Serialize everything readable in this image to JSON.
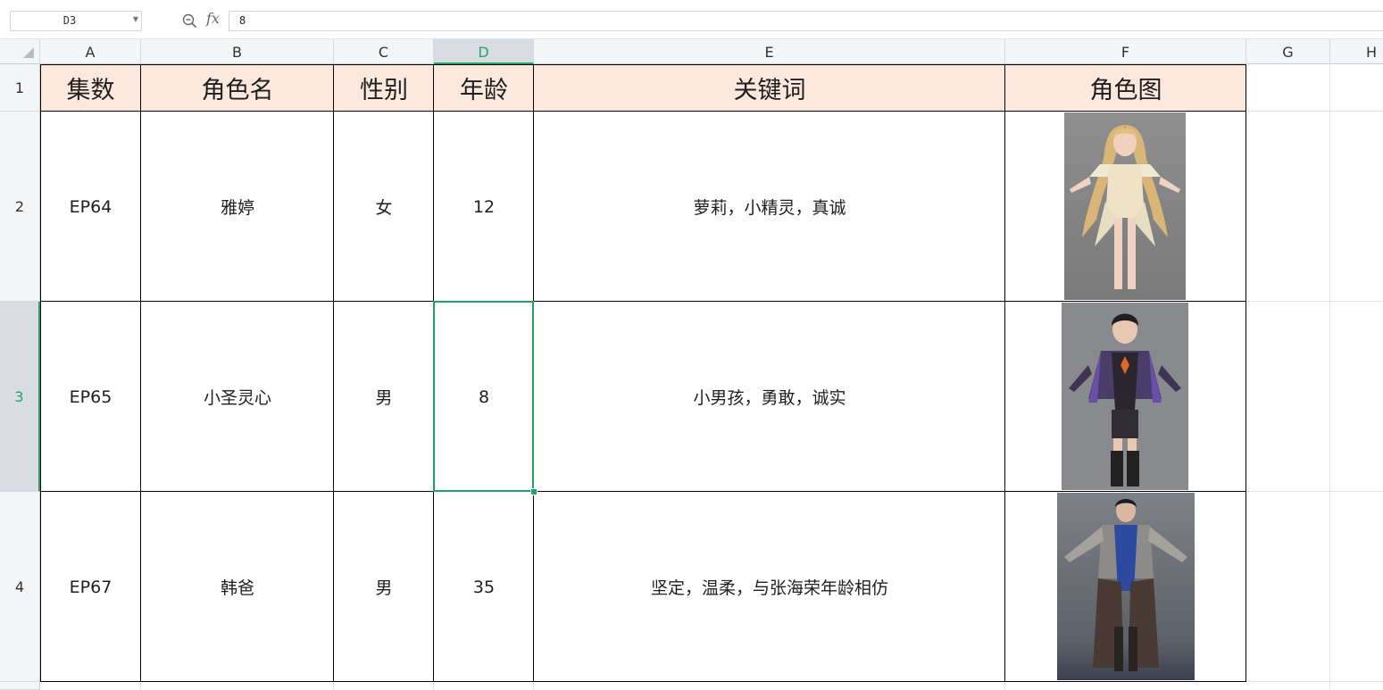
{
  "formula_bar": {
    "name_box": "D3",
    "fx_label": "fx",
    "formula_value": "8",
    "zoom_icon": "zoom-search-icon"
  },
  "columns": [
    "A",
    "B",
    "C",
    "D",
    "E",
    "F",
    "G",
    "H"
  ],
  "rows": [
    "1",
    "2",
    "3",
    "4"
  ],
  "selection": {
    "active_column": "D",
    "active_row": "3"
  },
  "table": {
    "headers": [
      "集数",
      "角色名",
      "性别",
      "年龄",
      "关键词",
      "角色图"
    ],
    "header_fill": "#fce8dc",
    "records": [
      {
        "episode": "EP64",
        "name": "雅婷",
        "gender": "女",
        "age": "12",
        "keywords": "萝莉，小精灵，真诚",
        "image": "elf-girl-portrait"
      },
      {
        "episode": "EP65",
        "name": "小圣灵心",
        "gender": "男",
        "age": "8",
        "keywords": "小男孩，勇敢，诚实",
        "image": "boy-portrait"
      },
      {
        "episode": "EP67",
        "name": "韩爸",
        "gender": "男",
        "age": "35",
        "keywords": "坚定，温柔，与张海荣年龄相仿",
        "image": "armored-man-portrait"
      }
    ]
  },
  "colors": {
    "accent": "#21a366",
    "header_bg": "#f4f5f7",
    "selected_header_bg": "#d9dde3"
  }
}
